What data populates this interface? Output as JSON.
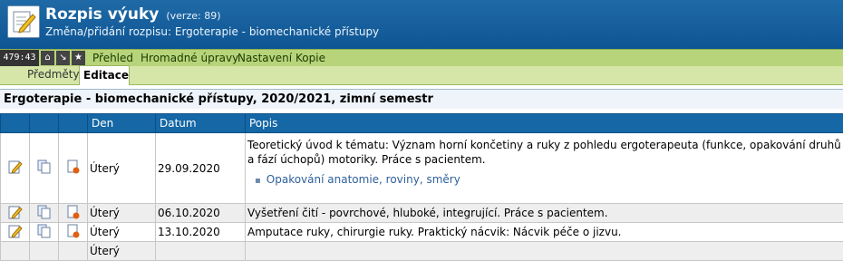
{
  "header": {
    "title": "Rozpis výuky",
    "version": "(verze: 89)",
    "subtitle": "Změna/přidání rozpisu: Ergoterapie - biomechanické přístupy"
  },
  "menubar": {
    "clock": "479:43",
    "icons": [
      "home-icon",
      "arrow-icon",
      "star-icon"
    ],
    "items": [
      "Přehled",
      "Hromadné úpravy",
      "Nastavení",
      "Kopie"
    ]
  },
  "tabs": {
    "inactive": "Předměty",
    "active": "Editace"
  },
  "page_title": "Ergoterapie - biomechanické přístupy, 2020/2021, zimní semestr",
  "table": {
    "headers": [
      "",
      "",
      "",
      "Den",
      "Datum",
      "Popis"
    ],
    "rows": [
      {
        "den": "Úterý",
        "datum": "29.09.2020",
        "popis": "Teoretický úvod k tématu: Význam horní končetiny a ruky z pohledu ergoterapeuta (funkce, opakování druhů a fází úchopů) motoriky. Práce s pacientem.",
        "sub_items": [
          "Opakování anatomie, roviny, směry"
        ]
      },
      {
        "den": "Úterý",
        "datum": "06.10.2020",
        "popis": "Vyšetření čití - povrchové, hluboké, integrující. Práce s pacientem."
      },
      {
        "den": "Úterý",
        "datum": "13.10.2020",
        "popis": "Amputace ruky, chirurgie ruky. Praktický nácvik: Nácvik péče o jizvu."
      },
      {
        "den": "Úterý",
        "datum": "",
        "popis": ""
      }
    ]
  },
  "colors": {
    "header_bg": "#0e5593",
    "menubar_bg": "#b8d47a",
    "tabbar_bg": "#d6e6a8",
    "table_header_bg": "#1567a6",
    "link": "#2d5f9a"
  }
}
